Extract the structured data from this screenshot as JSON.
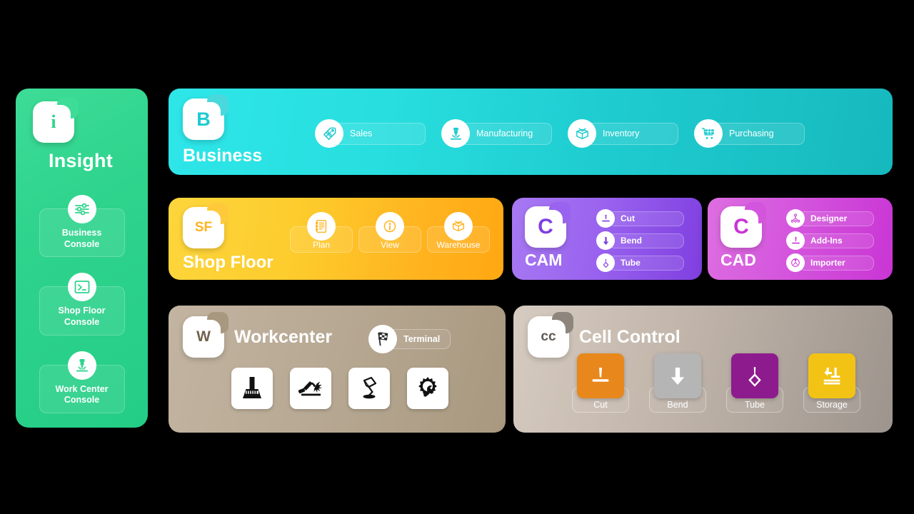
{
  "sidebar": {
    "app": {
      "name": "Insight",
      "icon": "insight-app-icon",
      "letter": "i",
      "color": "#2fd48d"
    },
    "items": [
      {
        "label_line1": "Business",
        "label_line2": "Console",
        "icon": "sliders-icon"
      },
      {
        "label_line1": "Shop Floor",
        "label_line2": "Console",
        "icon": "terminal-prompt-icon"
      },
      {
        "label_line1": "Work Center",
        "label_line2": "Console",
        "icon": "laser-head-icon"
      }
    ]
  },
  "business": {
    "name": "Business",
    "icon": "business-app-icon",
    "letter": "B",
    "color": "#1ecbcf",
    "links": [
      {
        "label": "Sales",
        "icon": "price-tags-icon"
      },
      {
        "label": "Manufacturing",
        "icon": "laser-head-icon"
      },
      {
        "label": "Inventory",
        "icon": "open-box-icon"
      },
      {
        "label": "Purchasing",
        "icon": "shopping-cart-icon"
      }
    ]
  },
  "shopfloor": {
    "name": "Shop Floor",
    "icon": "shopfloor-app-icon",
    "letter": "SF",
    "color": "#ffb31f",
    "links": [
      {
        "label": "Plan",
        "icon": "checklist-icon"
      },
      {
        "label": "View",
        "icon": "info-circle-icon"
      },
      {
        "label": "Warehouse",
        "icon": "open-box-icon"
      }
    ]
  },
  "cam": {
    "name": "CAM",
    "icon": "cam-app-icon",
    "letter": "C",
    "color": "#8b4fe8",
    "links": [
      {
        "label": "Cut",
        "icon": "cut-icon"
      },
      {
        "label": "Bend",
        "icon": "bend-icon"
      },
      {
        "label": "Tube",
        "icon": "tube-icon"
      }
    ]
  },
  "cad": {
    "name": "CAD",
    "icon": "cad-app-icon",
    "letter": "C",
    "color": "#c935d4",
    "links": [
      {
        "label": "Designer",
        "icon": "designer-icon"
      },
      {
        "label": "Add-Ins",
        "icon": "addins-icon"
      },
      {
        "label": "Importer",
        "icon": "importer-icon"
      }
    ]
  },
  "workcenter": {
    "name": "Workcenter",
    "icon": "workcenter-app-icon",
    "letter": "W",
    "color": "#a8987f",
    "terminal": {
      "label": "Terminal",
      "icon": "checkered-flag-icon"
    },
    "tools": [
      {
        "icon": "press-brake-icon"
      },
      {
        "icon": "welding-torch-icon"
      },
      {
        "icon": "bending-tool-icon"
      },
      {
        "icon": "gear-wrench-icon"
      }
    ]
  },
  "cellcontrol": {
    "name": "Cell Control",
    "icon": "cellcontrol-app-icon",
    "letter": "cc",
    "color": "#9d948d",
    "machines": [
      {
        "label": "Cut",
        "icon": "cut-icon",
        "color": "#e8881c"
      },
      {
        "label": "Bend",
        "icon": "bend-icon",
        "color": "#b5b5b5"
      },
      {
        "label": "Tube",
        "icon": "tube-icon",
        "color": "#8e1b8e"
      },
      {
        "label": "Storage",
        "icon": "storage-icon",
        "color": "#f2c314"
      }
    ]
  }
}
